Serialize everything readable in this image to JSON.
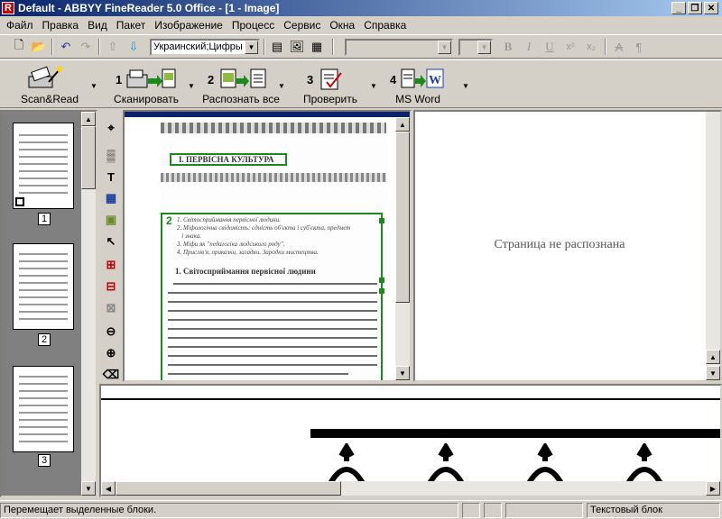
{
  "window": {
    "title": "Default - ABBYY FineReader 5.0 Office - [1 - Image]",
    "app_icon_letter": "R"
  },
  "menu": [
    "Файл",
    "Правка",
    "Вид",
    "Пакет",
    "Изображение",
    "Процесс",
    "Сервис",
    "Окна",
    "Справка"
  ],
  "toolbar1": {
    "language_combo": "Украинский;Цифры",
    "font_combo": "",
    "size_combo": "",
    "format_buttons": [
      "B",
      "I",
      "U",
      "x²",
      "x₂"
    ]
  },
  "toolbar2": {
    "scan_read": "Scan&Read",
    "steps": [
      {
        "num": "1",
        "label": "Сканировать"
      },
      {
        "num": "2",
        "label": "Распознать все"
      },
      {
        "num": "3",
        "label": "Проверить"
      },
      {
        "num": "4",
        "label": "MS Word"
      }
    ]
  },
  "thumbnails": [
    "1",
    "2",
    "3"
  ],
  "image": {
    "heading": "І. ПЕРВІСНА КУЛЬТУРА",
    "block_number": "2",
    "list": [
      "1. Світосприймання первісної людини.",
      "2. Міфологічна свідомість: єдність об'єкта і суб'єкта, предмет",
      "   і знака.",
      "3. Міфи як \"педагогіка людського роду\".",
      "4. Прислів'я, приказки, загадки. Зародки мистецтва."
    ],
    "section_title": "1. Світосприймання первісної людини"
  },
  "text_pane": {
    "message": "Страница не распознана"
  },
  "status": {
    "hint": "Перемещает выделенные блоки.",
    "block_type": "Текстовый блок"
  },
  "colors": {
    "title_start": "#0a246a",
    "title_end": "#a6caf0",
    "block": "#1a8a1a",
    "chrome": "#d4d0c8"
  }
}
